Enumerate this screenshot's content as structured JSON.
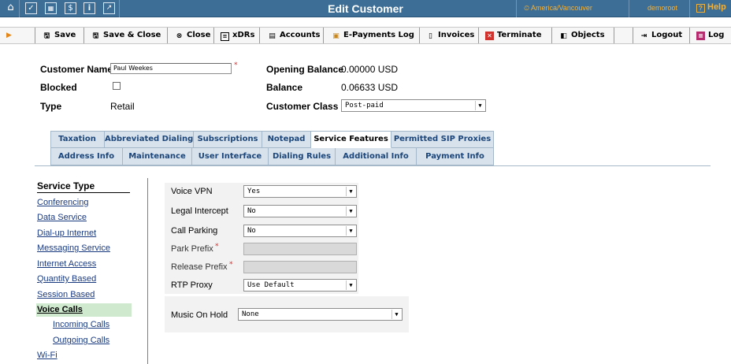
{
  "topbar": {
    "title": "Edit Customer",
    "timezone": "America/Vancouver",
    "username": "demoroot",
    "help_label": "Help",
    "help_box": "?",
    "icons": [
      {
        "name": "home-icon",
        "glyph": "⌂"
      },
      {
        "name": "checklist-icon",
        "glyph": "☑"
      },
      {
        "name": "grid-icon",
        "glyph": "▦"
      },
      {
        "name": "dollar-icon",
        "glyph": "$"
      },
      {
        "name": "info-icon",
        "glyph": "i"
      },
      {
        "name": "chart-icon",
        "glyph": "↗"
      }
    ]
  },
  "toolbar": {
    "save": "Save",
    "save_close": "Save & Close",
    "close": "Close",
    "xdrs": "xDRs",
    "accounts": "Accounts",
    "epayments": "E-Payments Log",
    "invoices": "Invoices",
    "terminate": "Terminate",
    "objects": "Objects",
    "logout": "Logout",
    "log": "Log"
  },
  "customer": {
    "name_label": "Customer Name",
    "name_value": "Paul Weekes",
    "required_mark": "*",
    "blocked_label": "Blocked",
    "type_label": "Type",
    "type_value": "Retail",
    "opening_balance_label": "Opening Balance",
    "opening_balance_value": "0.00000 USD",
    "balance_label": "Balance",
    "balance_value": "0.06633 USD",
    "class_label": "Customer Class",
    "class_value": "Post-paid"
  },
  "tabs": {
    "row1": [
      "Taxation",
      "Abbreviated Dialing",
      "Subscriptions",
      "Notepad",
      "Service Features",
      "Permitted SIP Proxies"
    ],
    "row2": [
      "Address Info",
      "Maintenance",
      "User Interface",
      "Dialing Rules",
      "Additional Info",
      "Payment Info"
    ],
    "active": "Service Features"
  },
  "nav": {
    "heading": "Service Type",
    "items": [
      "Conferencing",
      "Data Service",
      "Dial-up Internet",
      "Messaging Service",
      "Internet Access",
      "Quantity Based",
      "Session Based",
      "Voice Calls",
      "Incoming Calls",
      "Outgoing Calls",
      "Wi-Fi"
    ],
    "active": "Voice Calls"
  },
  "voice": {
    "vpn_label": "Voice VPN",
    "vpn_value": "Yes",
    "legal_label": "Legal Intercept",
    "legal_value": "No",
    "parking_label": "Call Parking",
    "parking_value": "No",
    "park_prefix_label": "Park Prefix",
    "release_prefix_label": "Release Prefix",
    "rtp_label": "RTP Proxy",
    "rtp_value": "Use Default",
    "moh_label": "Music On Hold",
    "moh_value": "None"
  },
  "colors": {
    "topbar": "#3d6e96",
    "accent_orange": "#f3b13a",
    "tab_bg": "#d7e2ec",
    "tab_text": "#1c467a",
    "nav_active": "#cfe9cf",
    "required": "#e32626"
  }
}
